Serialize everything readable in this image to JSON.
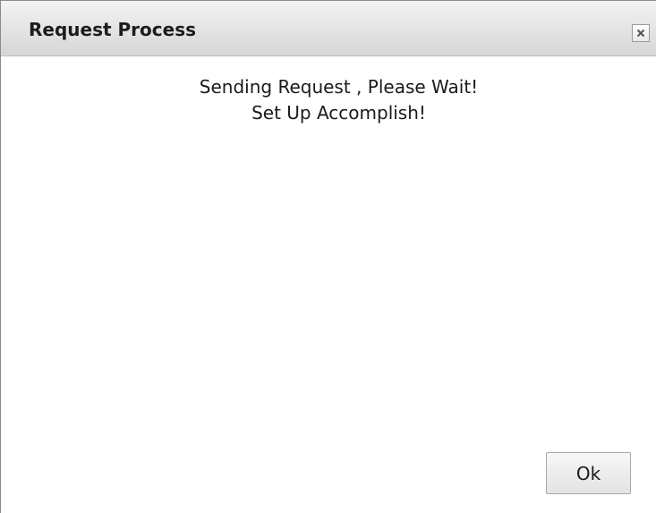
{
  "dialog": {
    "title": "Request Process",
    "close_icon": "close-icon",
    "messages": [
      "Sending Request , Please Wait!",
      "Set Up Accomplish!"
    ],
    "ok_label": "Ok"
  }
}
